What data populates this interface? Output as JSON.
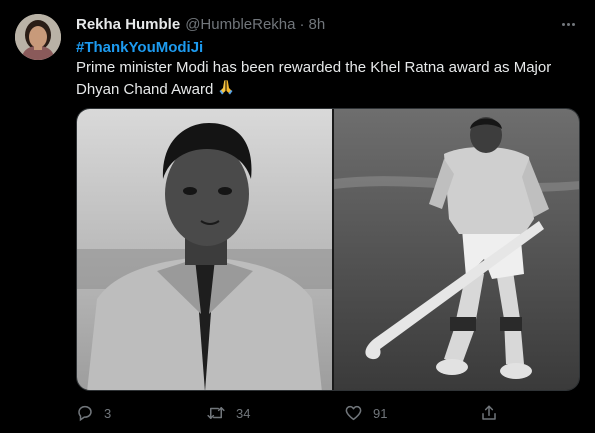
{
  "tweet": {
    "author": {
      "display_name": "Rekha Humble",
      "handle": "@HumbleRekha",
      "separator": "·",
      "time": "8h"
    },
    "hashtag": "#ThankYouModiJi",
    "text": "Prime minister Modi has been rewarded the Khel Ratna award as Major Dhyan Chand Award",
    "emoji_icon": "folded-hands-emoji",
    "media": {
      "count": 2,
      "images": [
        "portrait-photo",
        "hockey-player-photo"
      ]
    },
    "stats": {
      "replies": "3",
      "retweets": "34",
      "likes": "91"
    }
  },
  "theme": {
    "background": "#000000",
    "text_primary": "#e7e9ea",
    "text_secondary": "#71767b",
    "link": "#1d9bf0",
    "border": "#2f3336"
  },
  "icons": {
    "more": "more-dots-icon",
    "reply": "reply-icon",
    "retweet": "retweet-icon",
    "like": "heart-icon",
    "share": "share-icon"
  }
}
